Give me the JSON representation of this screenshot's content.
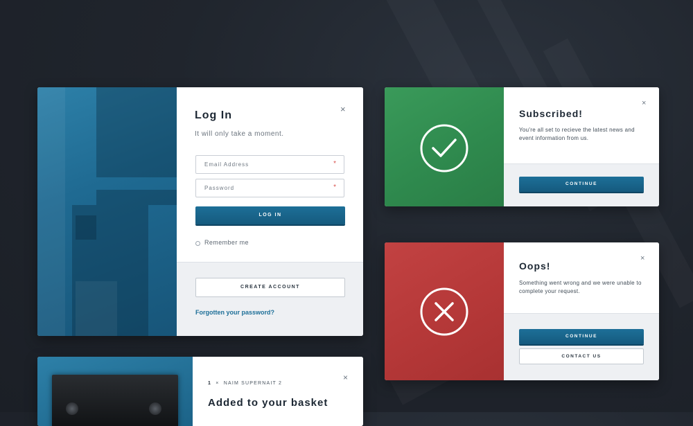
{
  "colors": {
    "primary": "#155a7e",
    "success": "#2f8a4e",
    "error": "#b53838",
    "background": "#20252d"
  },
  "login": {
    "title": "Log In",
    "subtitle": "It will only take a moment.",
    "email_placeholder": "Email Address",
    "password_placeholder": "Password",
    "required_marker": "*",
    "login_button": "LOG IN",
    "remember_label": "Remember me",
    "create_account_button": "CREATE ACCOUNT",
    "forgot_link": "Forgotten your password?",
    "close_icon": "×"
  },
  "subscribed": {
    "title": "Subscribed!",
    "message": "You're all set to recieve the latest news and event information from us.",
    "continue_button": "CONTINUE",
    "close_icon": "×",
    "status_icon": "checkmark-circle-icon"
  },
  "oops": {
    "title": "Oops!",
    "message": "Something went wrong and we were unable to complete your request.",
    "continue_button": "CONTINUE",
    "contact_button": "CONTACT US",
    "close_icon": "×",
    "status_icon": "x-circle-icon"
  },
  "basket": {
    "quantity": "1",
    "multiplier": "×",
    "product_name": "NAIM SUPERNAIT 2",
    "title": "Added to your basket",
    "close_icon": "×"
  }
}
